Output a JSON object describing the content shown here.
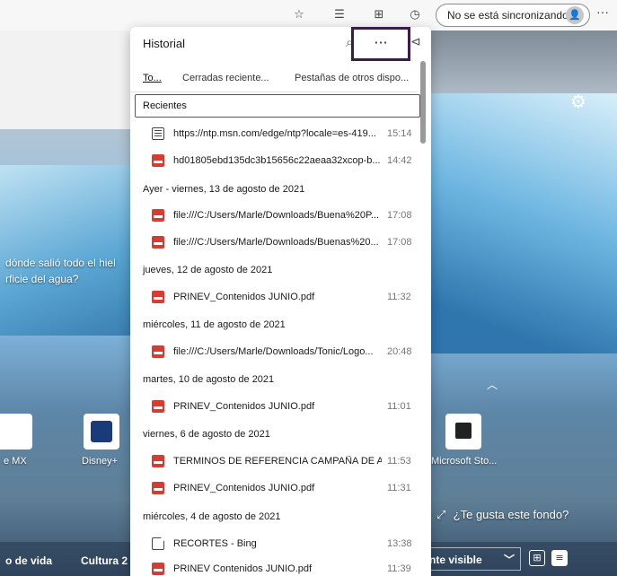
{
  "toolbar": {
    "sync_label": "No se está sincronizando",
    "more_label": "···"
  },
  "newtab": {
    "story_line1": "dónde salió todo el hiel",
    "story_line2": "rficie del agua?",
    "tiles": [
      "e MX",
      "Disney+",
      "Microsoft Sto..."
    ],
    "like_bg": "¿Te gusta este fondo?",
    "bottom_items": [
      "o de vida",
      "Cultura 2"
    ],
    "visible_btn": "nte visible"
  },
  "history": {
    "title": "Historial",
    "more_label": "···",
    "tabs": [
      "To...",
      "Cerradas reciente...",
      "Pestañas de otros dispo..."
    ],
    "recent_header": "Recientes",
    "entries": [
      {
        "title": "https://ntp.msn.com/edge/ntp?locale=es-419...",
        "time": "15:14",
        "icon": "page"
      },
      {
        "title": "hd01805ebd135dc3b15656c22aeaa32xcop-b...",
        "time": "14:42",
        "icon": "pdf"
      },
      {
        "title": "file:///C:/Users/Marle/Downloads/Buena%20P...",
        "time": "17:08",
        "icon": "pdf"
      },
      {
        "title": "file:///C:/Users/Marle/Downloads/Buenas%20...",
        "time": "17:08",
        "icon": "pdf"
      },
      {
        "title": "PRINEV_Contenidos JUNIO.pdf",
        "time": "11:32",
        "icon": "pdf"
      },
      {
        "title": "file:///C:/Users/Marle/Downloads/Tonic/Logo...",
        "time": "20:48",
        "icon": "pdf"
      },
      {
        "title": "PRINEV_Contenidos JUNIO.pdf",
        "time": "11:01",
        "icon": "pdf"
      },
      {
        "title": "TERMINOS DE REFERENCIA CAMPAÑA DE AW...",
        "time": "11:53",
        "icon": "pdf"
      },
      {
        "title": "PRINEV_Contenidos JUNIO.pdf",
        "time": "11:31",
        "icon": "pdf"
      },
      {
        "title": "RECORTES - Bing",
        "time": "13:38",
        "icon": "doc"
      },
      {
        "title": "PRINEV Contenidos JUNIO.pdf",
        "time": "11:39",
        "icon": "pdf"
      }
    ],
    "dates": [
      "Ayer - viernes, 13 de agosto de 2021",
      "jueves, 12 de agosto de 2021",
      "miércoles, 11 de agosto de 2021",
      "martes, 10 de agosto de 2021",
      "viernes, 6 de agosto de 2021",
      "miércoles, 4 de agosto de 2021"
    ]
  }
}
